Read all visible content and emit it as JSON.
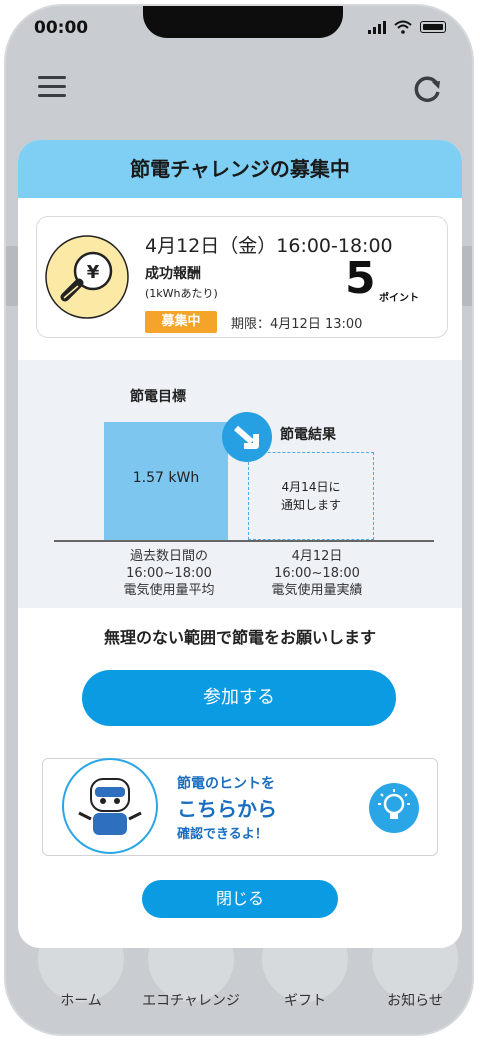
{
  "status_bar": {
    "time": "00:00"
  },
  "modal": {
    "title": "節電チャレンジの募集中",
    "challenge": {
      "date_time": "4月12日（金）16:00-18:00",
      "reward_label": "成功報酬",
      "reward_unit": "(1kWhあたり)",
      "points": "5",
      "points_unit": "ポイント",
      "status_badge": "募集中",
      "deadline": "期限：4月12日 13:00"
    },
    "chart": {
      "goal_label": "節電目標",
      "result_label": "節電結果",
      "goal_value": "1.57 kWh",
      "result_notice_line1": "4月14日に",
      "result_notice_line2": "通知します",
      "left_caption": [
        "過去数日間の",
        "16:00~18:00",
        "電気使用量平均"
      ],
      "right_caption": [
        "4月12日",
        "16:00~18:00",
        "電気使用量実績"
      ]
    },
    "message": "無理のない範囲で節電をお願いします",
    "join_button": "参加する",
    "hint_banner": {
      "line1": "節電のヒントを",
      "line2": "こちらから",
      "line3": "確認できるよ！"
    },
    "close_button": "閉じる"
  },
  "tabs": [
    {
      "label": "ホーム"
    },
    {
      "label": "エコチャレンジ"
    },
    {
      "label": "ギフト"
    },
    {
      "label": "お知らせ"
    }
  ],
  "colors": {
    "header_blue": "#7ecff3",
    "primary_blue": "#0a9be3",
    "badge_orange": "#f5a42a",
    "bar_blue": "#7cc6f0"
  }
}
